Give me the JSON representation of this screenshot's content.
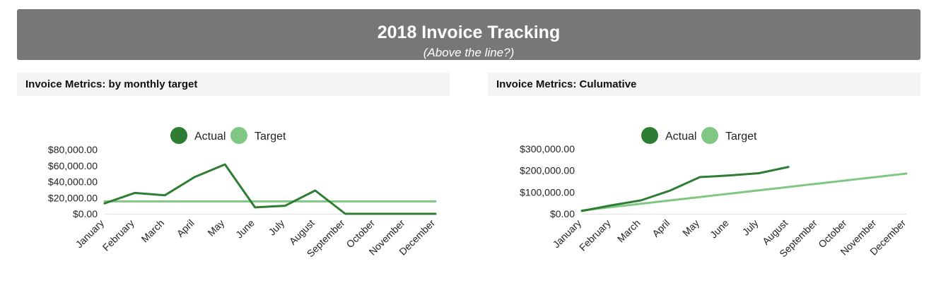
{
  "header": {
    "title": "2018 Invoice Tracking",
    "subtitle": "(Above the line?)"
  },
  "panels": {
    "left_title": "Invoice Metrics: by monthly target",
    "right_title": "Invoice Metrics: Culumative"
  },
  "colors": {
    "actual": "#2e7d32",
    "target": "#81c784",
    "banner": "#777777",
    "panel_header": "#f4f4f4"
  },
  "chart_data": [
    {
      "type": "line",
      "categories": [
        "January",
        "February",
        "March",
        "April",
        "May",
        "June",
        "July",
        "August",
        "September",
        "October",
        "November",
        "December"
      ],
      "series": [
        {
          "name": "Actual",
          "values": [
            13000,
            26000,
            23000,
            46000,
            61500,
            8000,
            10000,
            29000,
            0,
            0,
            0,
            0
          ]
        },
        {
          "name": "Target",
          "values": [
            15500,
            15500,
            15500,
            15500,
            15500,
            15500,
            15500,
            15500,
            15500,
            15500,
            15500,
            15500
          ]
        }
      ],
      "yticks": [
        0,
        20000,
        40000,
        60000,
        80000
      ],
      "ytick_labels": [
        "$0.00",
        "$20,000.00",
        "$40,000.00",
        "$60,000.00",
        "$80,000.00"
      ],
      "ylim": [
        0,
        80000
      ],
      "legend": "top-center",
      "grid": false
    },
    {
      "type": "line",
      "categories": [
        "January",
        "February",
        "March",
        "April",
        "May",
        "June",
        "July",
        "August",
        "September",
        "October",
        "November",
        "December"
      ],
      "series": [
        {
          "name": "Actual",
          "values": [
            13000,
            39000,
            62000,
            108000,
            169500,
            177500,
            187500,
            216500
          ]
        },
        {
          "name": "Target",
          "values": [
            15500,
            31000,
            46500,
            62000,
            77500,
            93000,
            108500,
            124000,
            139500,
            155000,
            170500,
            186000
          ]
        }
      ],
      "yticks": [
        0,
        100000,
        200000,
        300000
      ],
      "ytick_labels": [
        "$0.00",
        "$100,000.00",
        "$200,000.00",
        "$300,000.00"
      ],
      "ylim": [
        0,
        300000
      ],
      "legend": "top-center",
      "grid": false
    }
  ]
}
